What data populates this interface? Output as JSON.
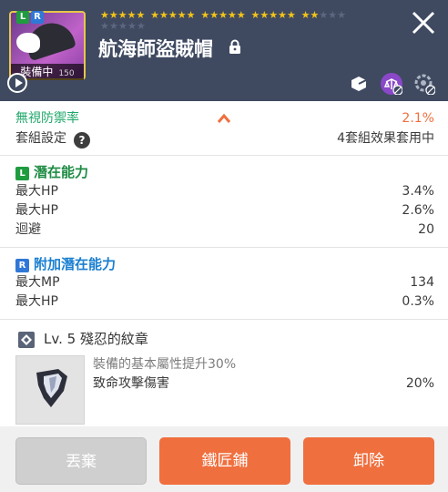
{
  "header": {
    "item_name": "航海師盜賊帽",
    "equipped_label": "裝備中",
    "level_small": "150",
    "potential_badge_l": "L",
    "potential_badge_r": "R",
    "stars_filled": 22,
    "stars_total": 30,
    "icons": [
      "play-icon",
      "lock-icon",
      "close-icon",
      "export-icon",
      "compare-icon",
      "disabled-settings-icon"
    ]
  },
  "stats": {
    "ignore_defense_label": "無視防禦率",
    "ignore_defense_value": "2.1%",
    "set_label": "套組設定",
    "set_value": "4套組效果套用中"
  },
  "potential": {
    "badge": "L",
    "title": "潛在能力",
    "lines": [
      {
        "label": "最大HP",
        "value": "3.4%"
      },
      {
        "label": "最大HP",
        "value": "2.6%"
      },
      {
        "label": "迴避",
        "value": "20"
      }
    ]
  },
  "additional_potential": {
    "badge": "R",
    "title": "附加潛在能力",
    "lines": [
      {
        "label": "最大MP",
        "value": "134"
      },
      {
        "label": "最大HP",
        "value": "0.3%"
      }
    ]
  },
  "emblem": {
    "title": "Lv. 5 殘忍的紋章",
    "desc": "裝備的基本屬性提升30%",
    "stat_label": "致命攻擊傷害",
    "stat_value": "20%"
  },
  "buttons": {
    "discard": "丟棄",
    "blacksmith": "鐵匠鋪",
    "unequip": "卸除"
  },
  "colors": {
    "header_bg": "#3f4a61",
    "accent_orange": "#f06f3e",
    "potential_blue": "#1a7fd0",
    "ignore_defense_green": "#22a86b"
  }
}
